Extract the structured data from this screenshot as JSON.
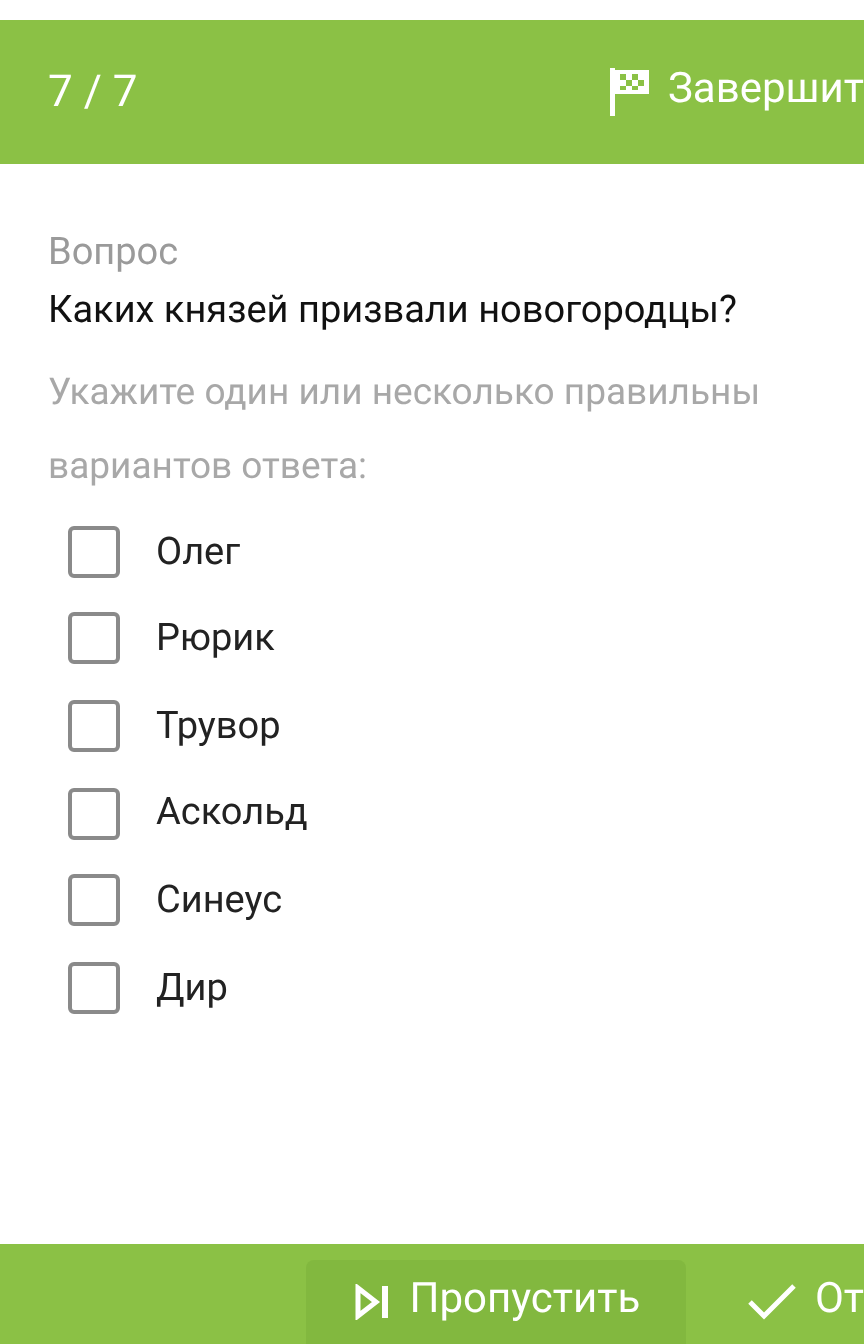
{
  "header": {
    "progress": "7 / 7",
    "finish_button": "Завершит"
  },
  "question": {
    "label": "Вопрос",
    "text": "Каких князей призвали новогородцы?",
    "hint_lines": [
      "Укажите один или несколько правильны",
      "вариантов ответа:"
    ]
  },
  "options": [
    {
      "label": "Олег",
      "checked": false
    },
    {
      "label": "Рюрик",
      "checked": false
    },
    {
      "label": "Трувор",
      "checked": false
    },
    {
      "label": "Аскольд",
      "checked": false
    },
    {
      "label": "Синеус",
      "checked": false
    },
    {
      "label": "Дир",
      "checked": false
    }
  ],
  "footer": {
    "skip_button": "Пропустить",
    "answer_button": "От"
  }
}
